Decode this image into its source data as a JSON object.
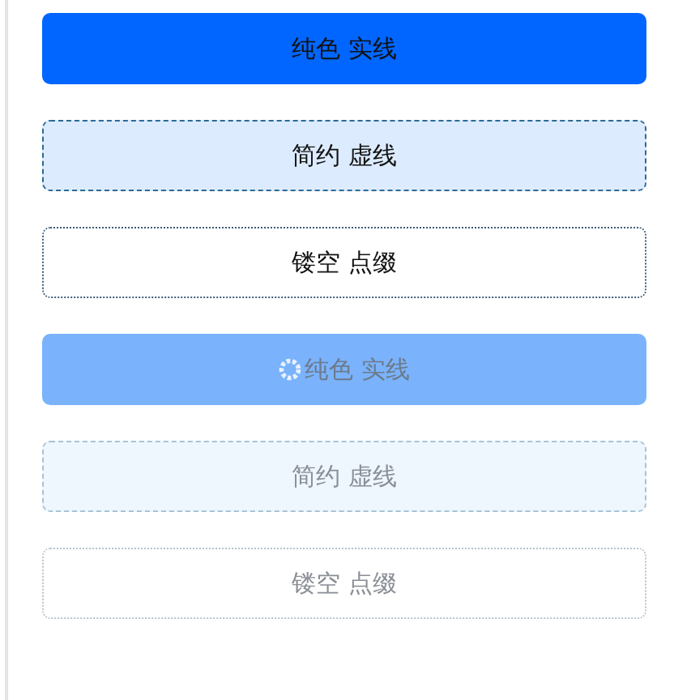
{
  "buttons": [
    {
      "label": "纯色 实线",
      "kind": "solid",
      "disabled": false,
      "loading": false
    },
    {
      "label": "简约 虚线",
      "kind": "dashed",
      "disabled": false,
      "loading": false
    },
    {
      "label": "镂空 点缀",
      "kind": "dotted",
      "disabled": false,
      "loading": false
    },
    {
      "label": "纯色 实线",
      "kind": "solid",
      "disabled": true,
      "loading": true
    },
    {
      "label": "简约 虚线",
      "kind": "dashed",
      "disabled": true,
      "loading": false
    },
    {
      "label": "镂空 点缀",
      "kind": "dotted",
      "disabled": true,
      "loading": false
    }
  ]
}
